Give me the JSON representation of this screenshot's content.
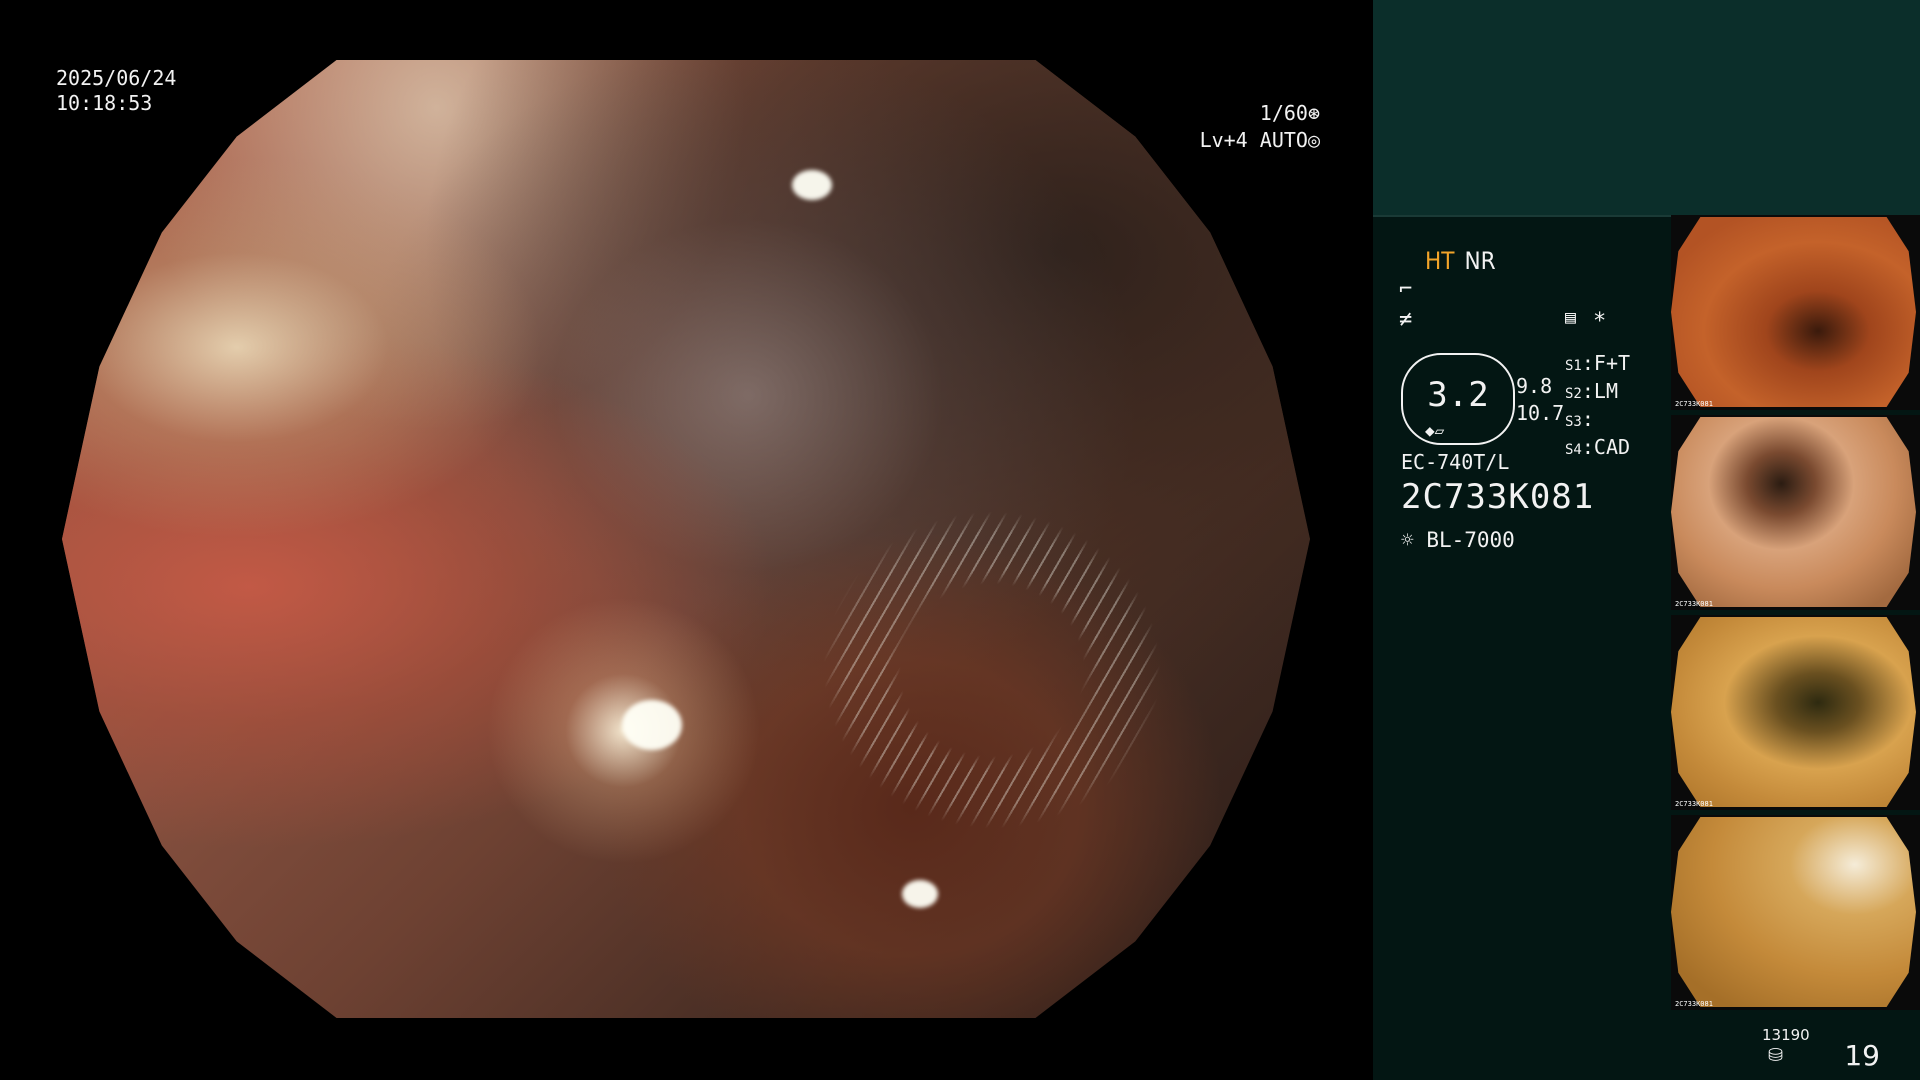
{
  "osd": {
    "date": "2025/06/24",
    "time": "10:18:53",
    "shutter": "1/60",
    "shutter_icon": "shutter-icon",
    "level": "Lv+4",
    "mode": "AUTO",
    "mode_icon": "iris-icon"
  },
  "panel": {
    "ht": "HT",
    "nr": "NR",
    "icons": [
      "enhance-icon",
      "gamma-icon",
      "menu-icon",
      "asterisk-icon",
      "light-bulb-icon"
    ],
    "asterisk": "*",
    "zoom_value": "3.2",
    "vals": [
      "9.8",
      "10.7"
    ],
    "slots": [
      {
        "id": "S1",
        "value": "F+T"
      },
      {
        "id": "S2",
        "value": "LM"
      },
      {
        "id": "S3",
        "value": ""
      },
      {
        "id": "S4",
        "value": "CAD"
      }
    ],
    "scope_model": "EC-740T/L",
    "serial": "2C733K081",
    "light_source": "BL-7000",
    "frames": "13190",
    "counter": "19",
    "accent_color": "#f2a42a",
    "panel_color": "#0b2e2a"
  },
  "thumbnails": [
    {
      "label": "2C733K081"
    },
    {
      "label": "2C733K081"
    },
    {
      "label": "2C733K081"
    },
    {
      "label": "2C733K081"
    }
  ]
}
